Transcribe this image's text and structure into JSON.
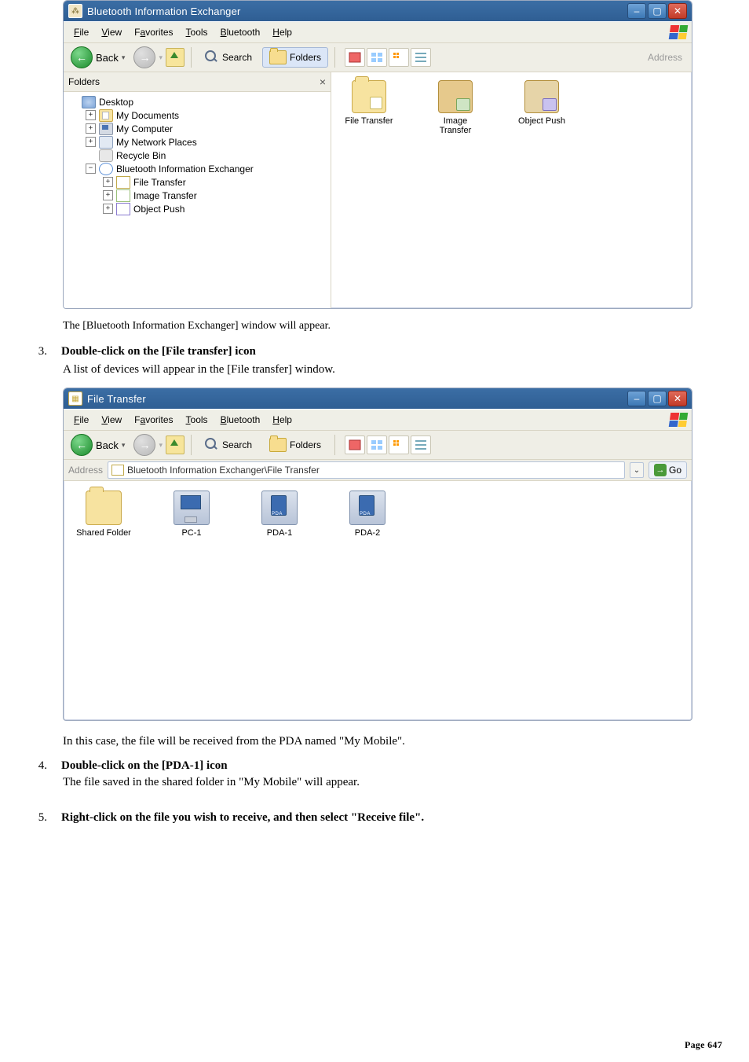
{
  "window1": {
    "title": "Bluetooth Information Exchanger",
    "menus": {
      "file": "File",
      "view": "View",
      "favorites": "Favorites",
      "tools": "Tools",
      "bluetooth": "Bluetooth",
      "help": "Help"
    },
    "toolbar": {
      "back": "Back",
      "search": "Search",
      "folders": "Folders",
      "address_label": "Address"
    },
    "folders_pane": {
      "header": "Folders",
      "tree": {
        "desktop": "Desktop",
        "my_documents": "My Documents",
        "my_computer": "My Computer",
        "my_network": "My Network Places",
        "recycle_bin": "Recycle Bin",
        "bt_exchanger": "Bluetooth Information Exchanger",
        "file_transfer": "File Transfer",
        "image_transfer": "Image Transfer",
        "object_push": "Object Push"
      }
    },
    "content": {
      "file_transfer": "File Transfer",
      "image_transfer_l1": "Image",
      "image_transfer_l2": "Transfer",
      "object_push": "Object Push"
    }
  },
  "window2": {
    "title": "File Transfer",
    "menus": {
      "file": "File",
      "view": "View",
      "favorites": "Favorites",
      "tools": "Tools",
      "bluetooth": "Bluetooth",
      "help": "Help"
    },
    "toolbar": {
      "back": "Back",
      "search": "Search",
      "folders": "Folders"
    },
    "address": {
      "label": "Address",
      "value": "Bluetooth Information Exchanger\\File Transfer",
      "go": "Go"
    },
    "items": {
      "shared_folder": "Shared Folder",
      "pc1": "PC-1",
      "pda1": "PDA-1",
      "pda2": "PDA-2"
    },
    "pda_label_small": "PDA"
  },
  "doc": {
    "after_win1": "The [Bluetooth Information Exchanger] window will appear.",
    "step3_num": "3.",
    "step3_title": "Double-click on the [File transfer] icon",
    "step3_body": "A list of devices will appear in the [File transfer] window.",
    "after_win2": "In this case, the file will be received from the PDA named \"My Mobile\".",
    "step4_num": "4.",
    "step4_title": "Double-click on the [PDA-1] icon",
    "step4_body": "The file saved in the shared folder in \"My Mobile\" will appear.",
    "step5_num": "5.",
    "step5_title": "Right-click on the file you wish to receive, and then select \"Receive file\".",
    "page_label": "Page ",
    "page_num": "647"
  }
}
